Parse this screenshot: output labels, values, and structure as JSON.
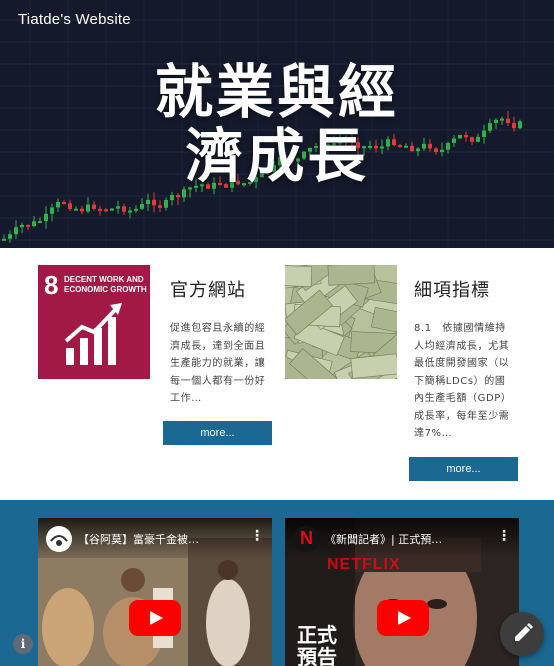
{
  "header": {
    "site_title": "Tiatde's Website"
  },
  "hero": {
    "title_line1": "就業與經",
    "title_line2": "濟成長"
  },
  "cards": [
    {
      "image": "sdg-goal-8-tile",
      "image_number": "8",
      "image_caption": "DECENT WORK AND ECONOMIC GROWTH",
      "title": "官方網站",
      "text_lines": [
        "促進包容且永續的經",
        "濟成長，達到全面且",
        "生產能力的就業，讓",
        "每一個人都有一份好",
        "工作…"
      ],
      "button": "more..."
    },
    {
      "image": "money-pile-photo",
      "title": "細項指標",
      "text_lines": [
        "8.1　依據國情維持",
        "人均經濟成長，尤其",
        "最低度開發國家（以",
        "下簡稱LDCs）的國",
        "內生產毛額（GDP）",
        "成長率，每年至少需",
        "達7%…"
      ],
      "button": "more..."
    }
  ],
  "videos": [
    {
      "title": "【谷阿莫】富豪千金被…",
      "channel_icon": "channel-avatar-icon"
    },
    {
      "title": "《新聞記者》| 正式預…",
      "channel_icon": "netflix-logo-icon",
      "overlay_line1": "正式",
      "overlay_line2": "預告",
      "watermark": "NETFLIX"
    }
  ],
  "colors": {
    "hero_bg": "#141a2c",
    "candle_up": "#2fb24a",
    "candle_down": "#e23a3a",
    "accent": "#1b6892",
    "sdg_red": "#a11944",
    "youtube_red": "#ff0000"
  },
  "icons": {
    "info": "info-icon",
    "edit": "pencil-icon",
    "play": "play-icon",
    "menu": "more-vertical-icon"
  }
}
